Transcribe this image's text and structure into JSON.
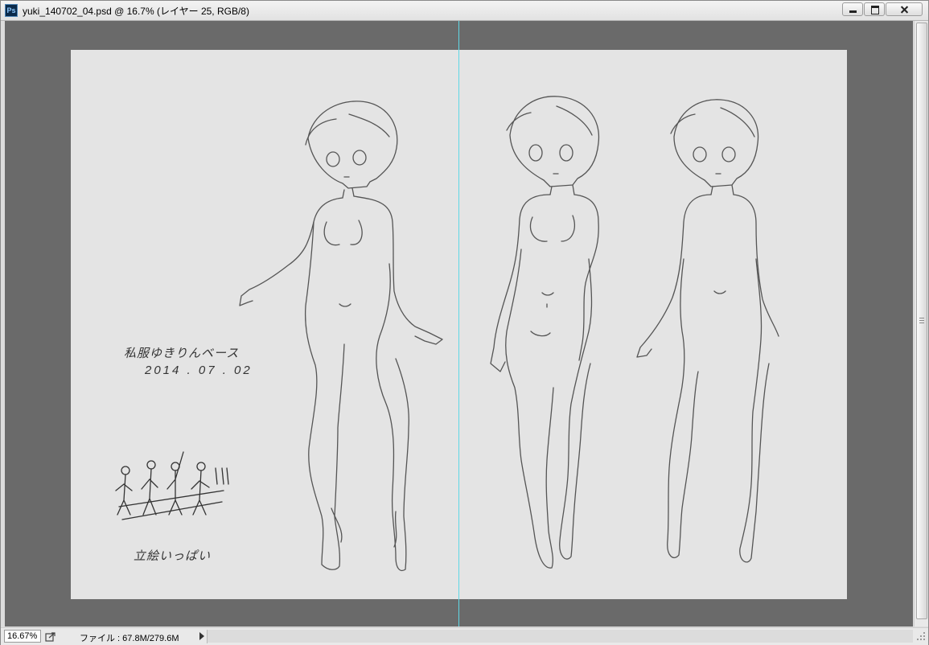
{
  "window": {
    "title": "yuki_140702_04.psd @ 16.7% (レイヤー 25, RGB/8)",
    "app_icon": "Ps",
    "controls": {
      "minimize": "minimize-icon",
      "maximize": "maximize-icon",
      "close": "close-icon"
    }
  },
  "canvas": {
    "zoom": "16.7%",
    "layer": "レイヤー 25",
    "color_mode": "RGB/8",
    "guide_color": "#5fd8e6",
    "pasteboard_color": "#6a6a6a",
    "artboard_color": "#e4e4e4",
    "notes": {
      "line1": "私服ゆきりんベース",
      "line2": "2014 . 07 . 02",
      "bottom": "立絵いっぱい"
    },
    "figures": [
      "figure-left",
      "figure-middle",
      "figure-right"
    ]
  },
  "statusbar": {
    "zoom_value": "16.67%",
    "file_info": "ファイル : 67.8M/279.6M"
  }
}
